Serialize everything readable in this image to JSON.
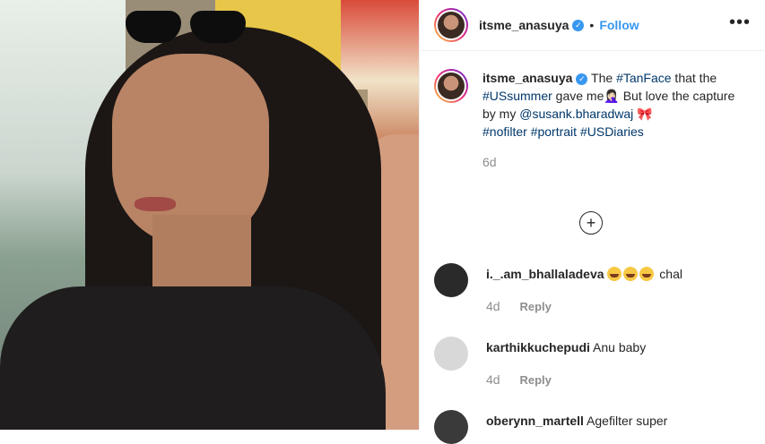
{
  "post_author": {
    "username": "itsme_anasuya",
    "follow_label": "Follow",
    "separator": "•",
    "more_label": "•••"
  },
  "caption": {
    "username": "itsme_anasuya",
    "text_parts": {
      "p1": "The ",
      "tag1": "#TanFace",
      "p2": " that the ",
      "tag2": "#USsummer",
      "p3": " gave me",
      "emoji": "🤦🏻‍♀️",
      "p4": " But love the capture by my ",
      "mention": "@susank.bharadwaj",
      "p5": " 🎀",
      "tag3": "#nofilter",
      "tag4": "#portrait",
      "tag5": "#USDiaries"
    },
    "time": "6d"
  },
  "load_more_icon": "plus-circle-icon",
  "comments": [
    {
      "username": "i._.am_bhallaladeva",
      "text": " chal",
      "emoji_count": 3,
      "time": "4d",
      "reply": "Reply",
      "avatar_color": "#2a2a2a"
    },
    {
      "username": "karthikkuchepudi",
      "text": " Anu baby",
      "time": "4d",
      "reply": "Reply",
      "avatar_color": "#d8d8d8"
    },
    {
      "username": "oberynn_martell",
      "text": " Agefilter super",
      "avatar_color": "#3a3a3a"
    }
  ],
  "colors": {
    "link": "#3897f0",
    "muted": "#8e8e8e",
    "text": "#262626"
  }
}
